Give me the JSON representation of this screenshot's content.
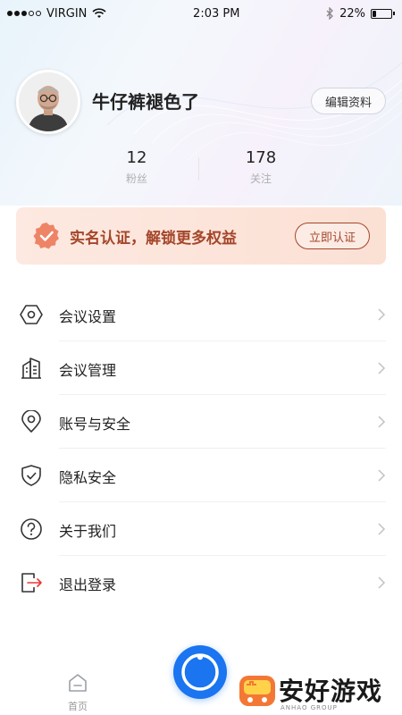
{
  "status_bar": {
    "carrier": "VIRGIN",
    "time": "2:03 PM",
    "battery": "22%",
    "battery_level": 0.22
  },
  "profile": {
    "username": "牛仔裤褪色了",
    "edit_label": "编辑资料",
    "stats": [
      {
        "value": "12",
        "label": "粉丝"
      },
      {
        "value": "178",
        "label": "关注"
      }
    ]
  },
  "verify": {
    "text": "实名认证，解锁更多权益",
    "button": "立即认证"
  },
  "menu": {
    "items": [
      {
        "label": "会议设置",
        "icon": "hexagon-settings-icon"
      },
      {
        "label": "会议管理",
        "icon": "building-icon"
      },
      {
        "label": "账号与安全",
        "icon": "location-pin-icon"
      },
      {
        "label": "隐私安全",
        "icon": "shield-check-icon"
      },
      {
        "label": "关于我们",
        "icon": "question-circle-icon"
      },
      {
        "label": "退出登录",
        "icon": "logout-icon"
      }
    ]
  },
  "tabbar": {
    "home_label": "首页"
  },
  "watermark": {
    "text": "安好游戏",
    "sub": "ANHAO GROUP"
  },
  "colors": {
    "accent_blue": "#1b74f0",
    "verify_text": "#a4462a",
    "verify_bg": "#fbe0d4",
    "logout_accent": "#e53935"
  }
}
